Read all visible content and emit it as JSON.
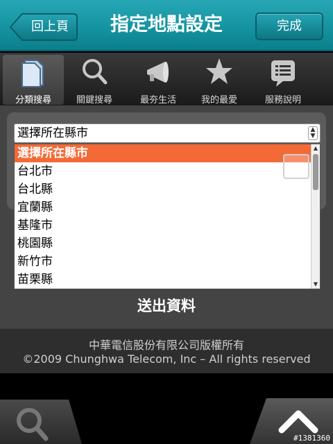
{
  "header": {
    "back_label": "回上頁",
    "title": "指定地點設定",
    "done_label": "完成"
  },
  "tabs": [
    {
      "label": "分類搜尋",
      "icon": "folder-icon",
      "active": true
    },
    {
      "label": "關鍵搜尋",
      "icon": "search-icon",
      "active": false
    },
    {
      "label": "最夯生活",
      "icon": "megaphone-icon",
      "active": false
    },
    {
      "label": "我的最愛",
      "icon": "star-icon",
      "active": false
    },
    {
      "label": "服務說明",
      "icon": "list-icon",
      "active": false
    }
  ],
  "county_select": {
    "value": "選擇所在縣市",
    "options": [
      "選擇所在縣市",
      "台北市",
      "台北縣",
      "宜蘭縣",
      "基隆市",
      "桃園縣",
      "新竹市",
      "苗栗縣"
    ],
    "selected_index": 0
  },
  "submit_label": "送出資料",
  "footer": {
    "line1": "中華電信股份有限公司版權所有",
    "line2": "©2009 Chunghwa Telecom, Inc – All rights reserved"
  },
  "watermark": "#1381360",
  "colors": {
    "header_teal": "#1593a1",
    "selected_option": "#f36a37"
  }
}
